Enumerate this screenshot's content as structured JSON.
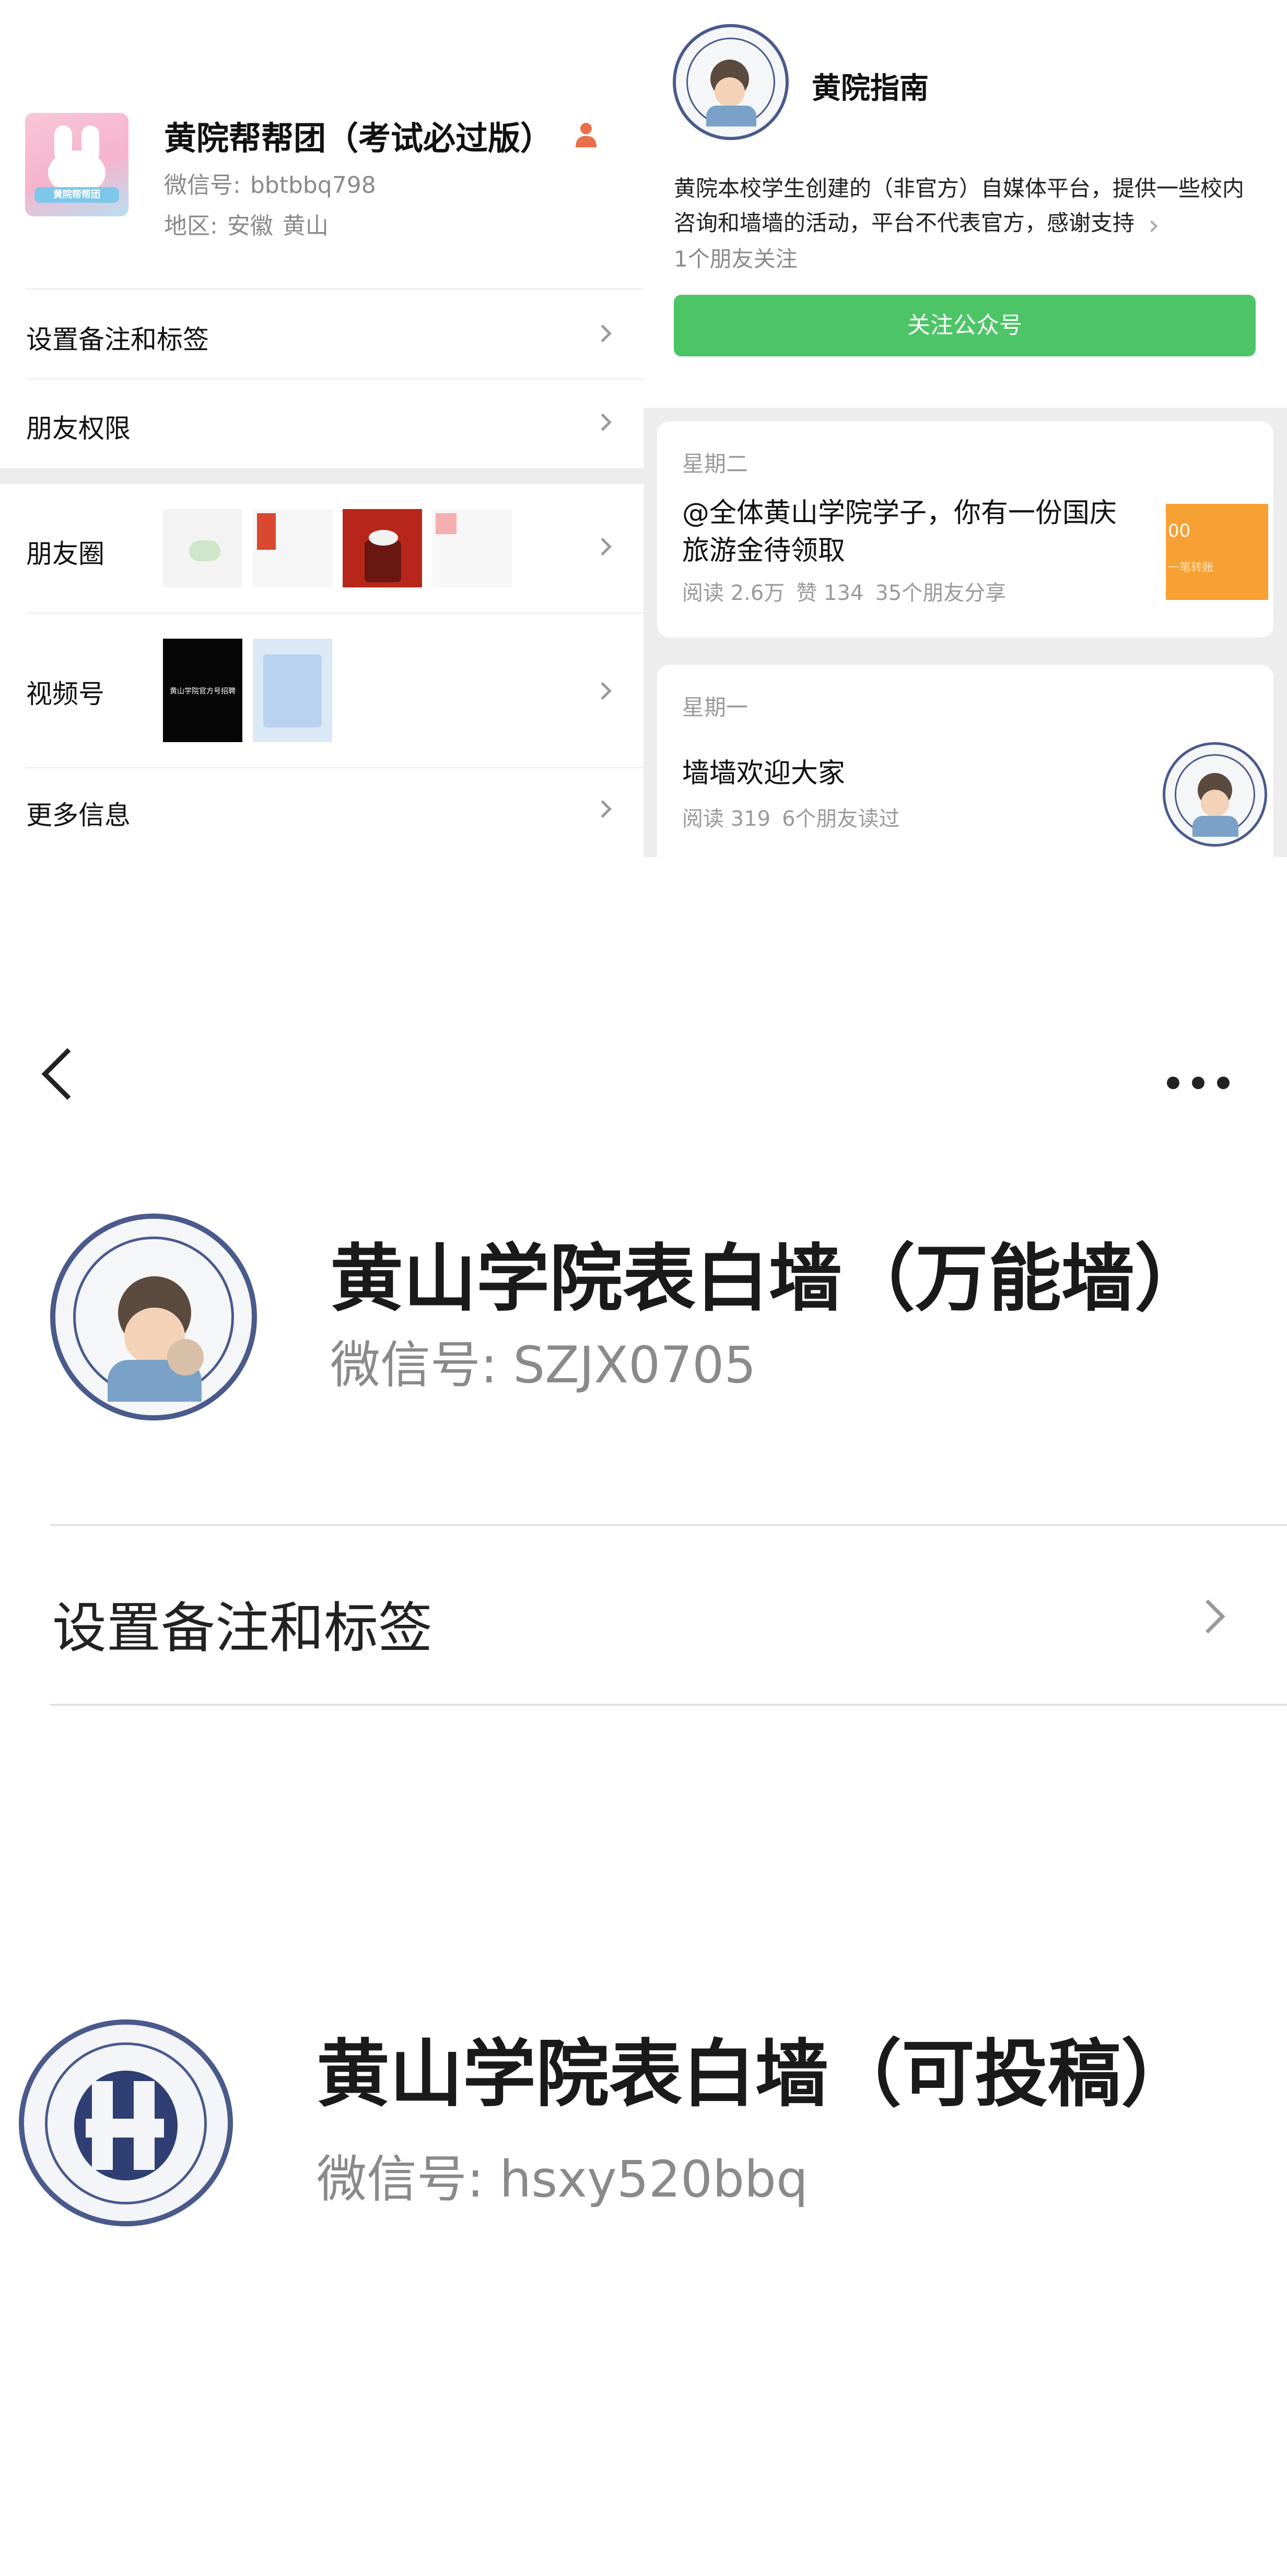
{
  "contact": {
    "name": "黄院帮帮团（考试必过版）",
    "wechat_id_label": "微信号:",
    "wechat_id": "bbtbbq798",
    "region_label": "地区:",
    "region_province": "安徽",
    "region_city": "黄山",
    "avatar_caption": "黄院帮帮团",
    "menu": {
      "remarks": "设置备注和标签",
      "permissions": "朋友权限",
      "moments": "朋友圈",
      "channels": "视频号",
      "more": "更多信息"
    },
    "channel_thumb_text": "黄山学院官方号招聘"
  },
  "official_account": {
    "name": "黄院指南",
    "description": "黄院本校学生创建的（非官方）自媒体平台，提供一些校内咨询和墙墙的活动，平台不代表官方，感谢支持",
    "followers_text": "1个朋友关注",
    "follow_button": "关注公众号",
    "articles": [
      {
        "day": "星期二",
        "title": "@全体黄山学院学子，你有一份国庆旅游金待领取",
        "reads": "阅读 2.6万",
        "likes": "赞 134",
        "shares": "35个朋友分享",
        "thumb_text": "00",
        "thumb_sub": "一笔转账"
      },
      {
        "day": "星期一",
        "title": "墙墙欢迎大家",
        "reads": "阅读 319",
        "friends": "6个朋友读过"
      }
    ]
  },
  "profile_wall": {
    "name": "黄山学院表白墙（万能墙）",
    "wechat_id_label": "微信号:",
    "wechat_id": "SZJX0705",
    "remarks": "设置备注和标签"
  },
  "profile_submit": {
    "name": "黄山学院表白墙（可投稿）",
    "wechat_id_label": "微信号:",
    "wechat_id": "hsxy520bbq"
  },
  "colors": {
    "accent_green": "#4dc567",
    "orange_thumb": "#f7a033",
    "seal_navy": "#4a5a8c",
    "divider_gray": "#ececec"
  }
}
